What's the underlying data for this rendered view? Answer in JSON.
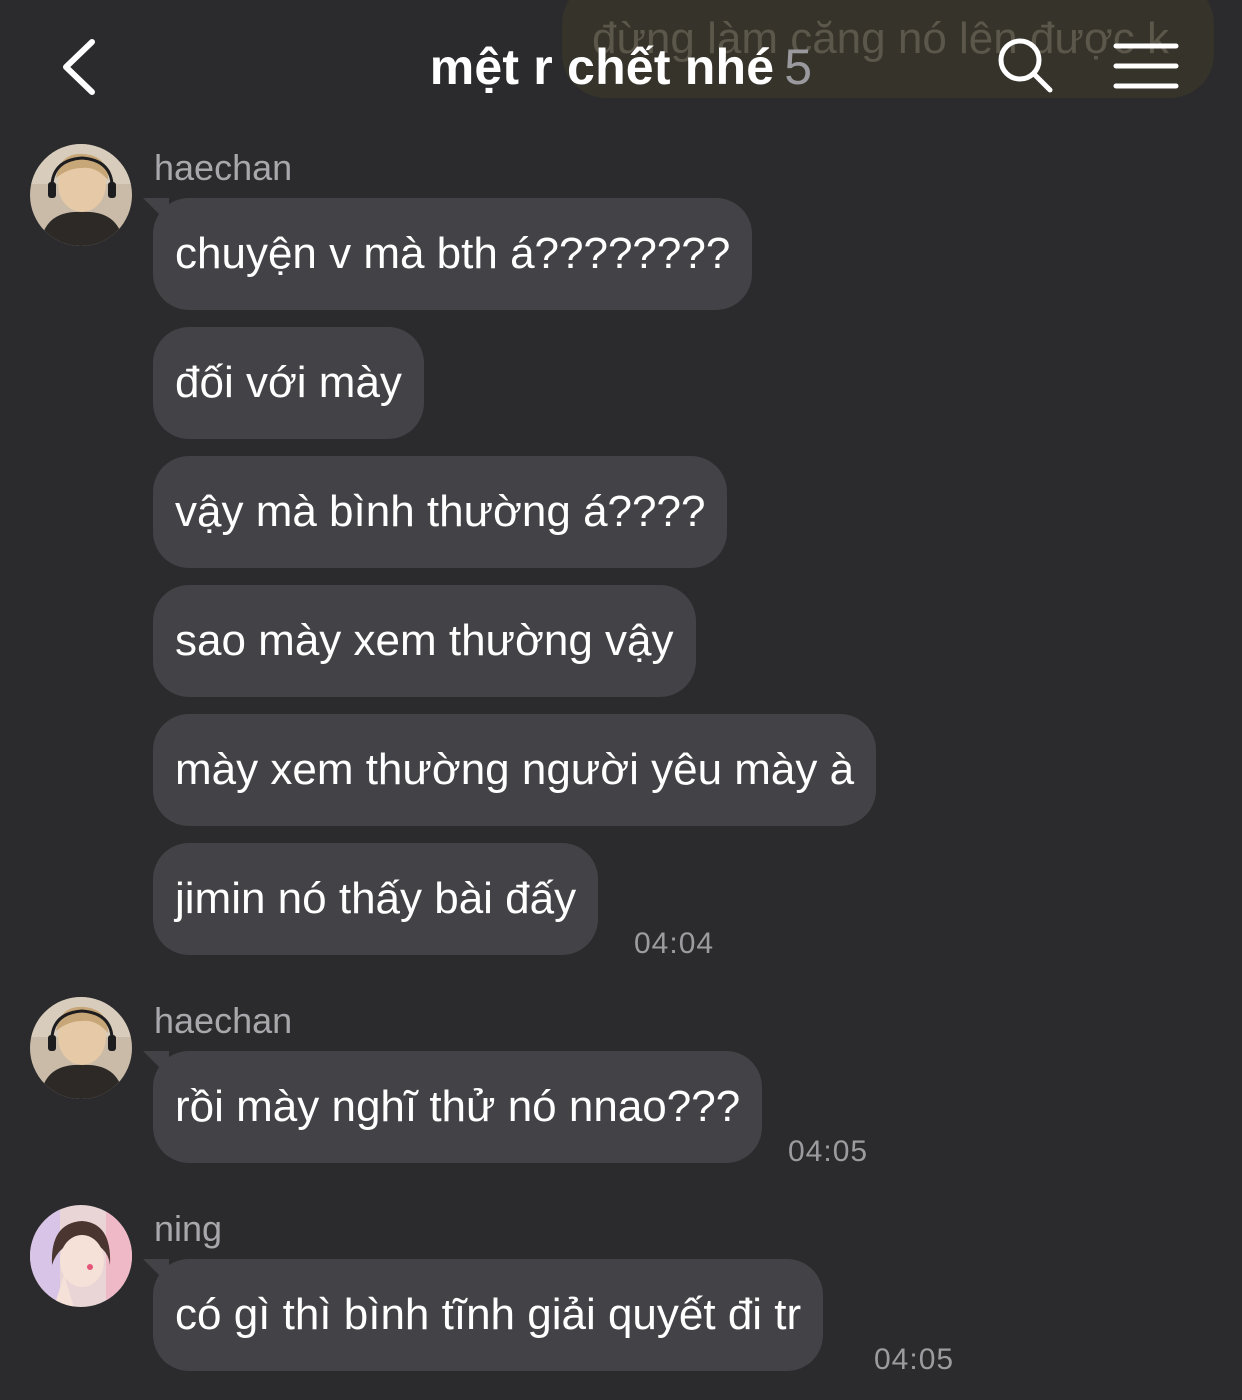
{
  "header": {
    "title": "mệt r chết nhé",
    "member_count": "5",
    "ghost_message": "đừng làm căng nó lên được k"
  },
  "groups": [
    {
      "sender": "haechan",
      "messages": [
        "chuyện v mà bth á????????",
        "đối với mày",
        "vậy mà bình thường á????",
        "sao mày xem thường vậy",
        "mày xem thường người yêu mày à",
        "jimin nó thấy bài đấy"
      ],
      "time": "04:04"
    },
    {
      "sender": "haechan",
      "messages": [
        "rồi mày nghĩ thử nó nnao???"
      ],
      "time": "04:05"
    },
    {
      "sender": "ning",
      "messages": [
        "có gì thì bình tĩnh giải quyết đi tr"
      ],
      "time": "04:05"
    }
  ],
  "colors": {
    "background": "#2b2b2e",
    "bubble_incoming": "#434347",
    "text_secondary": "#a8a8ac"
  },
  "icons": [
    "chevron-left-icon",
    "search-icon",
    "menu-icon"
  ]
}
